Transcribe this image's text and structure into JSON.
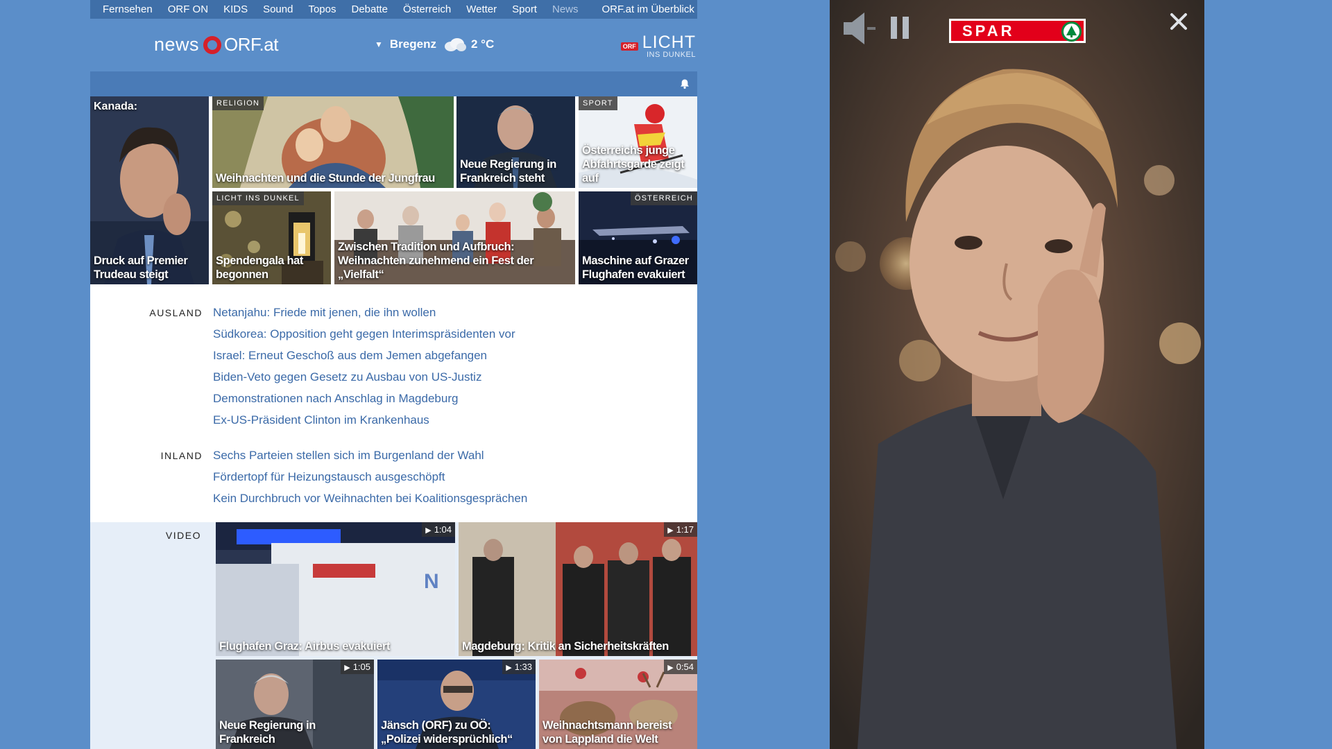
{
  "topnav": {
    "items": [
      "Fernsehen",
      "ORF ON",
      "KIDS",
      "Sound",
      "Topos",
      "Debatte",
      "Österreich",
      "Wetter",
      "Sport",
      "News"
    ],
    "overview": "ORF.at im Überblick"
  },
  "header": {
    "logo_news": "news",
    "logo_orf": "ORF.at",
    "weather_city": "Bregenz",
    "weather_temp": "2 °C",
    "lid_badge": "ORF",
    "lid_title": "LICHT",
    "lid_sub": "INS DUNKEL"
  },
  "tiles": {
    "t1": {
      "topcap": "Kanada:",
      "caption": "Druck auf Premier Trudeau steigt"
    },
    "t2": {
      "tag": "RELIGION",
      "caption": "Weihnachten und die Stunde der Jungfrau"
    },
    "t3": {
      "caption": "Neue Regierung in Frankreich steht"
    },
    "t4": {
      "tag": "SPORT",
      "caption": "Österreichs junge Abfahrtsgarde zeigt auf"
    },
    "t5": {
      "tag": "LICHT INS DUNKEL",
      "caption": "Spendengala hat begonnen"
    },
    "t6": {
      "caption": "Zwischen Tradition und Aufbruch: Weihnachten zunehmend ein Fest der „Vielfalt“"
    },
    "t7": {
      "tag": "ÖSTERREICH",
      "caption": "Maschine auf Grazer Flughafen evakuiert"
    }
  },
  "ausland": {
    "label": "AUSLAND",
    "links": [
      "Netanjahu: Friede mit jenen, die ihn wollen",
      "Südkorea: Opposition geht gegen Interimspräsidenten vor",
      "Israel: Erneut Geschoß aus dem Jemen abgefangen",
      "Biden-Veto gegen Gesetz zu Ausbau von US-Justiz",
      "Demonstrationen nach Anschlag in Magdeburg",
      "Ex-US-Präsident Clinton im Krankenhaus"
    ]
  },
  "inland": {
    "label": "INLAND",
    "links": [
      "Sechs Parteien stellen sich im Burgenland der Wahl",
      "Fördertopf für Heizungstausch ausgeschöpft",
      "Kein Durchbruch vor Weihnachten bei Koalitionsgesprächen"
    ]
  },
  "video": {
    "label": "VIDEO",
    "items": [
      {
        "caption": "Flughafen Graz: Airbus evakuiert",
        "duration": "1:04"
      },
      {
        "caption": "Magdeburg: Kritik an Sicherheitskräften",
        "duration": "1:17"
      },
      {
        "caption": "Neue Regierung in Frankreich",
        "duration": "1:05"
      },
      {
        "caption": "Jänsch (ORF) zu OÖ: „Polizei widersprüchlich“",
        "duration": "1:33"
      },
      {
        "caption": "Weihnachtsmann bereist von Lappland die Welt",
        "duration": "0:54"
      }
    ]
  },
  "ad": {
    "brand": "SPAR",
    "brand_color": "#e2001a",
    "icons": [
      "speaker-muted-icon",
      "pause-icon",
      "close-icon"
    ]
  }
}
